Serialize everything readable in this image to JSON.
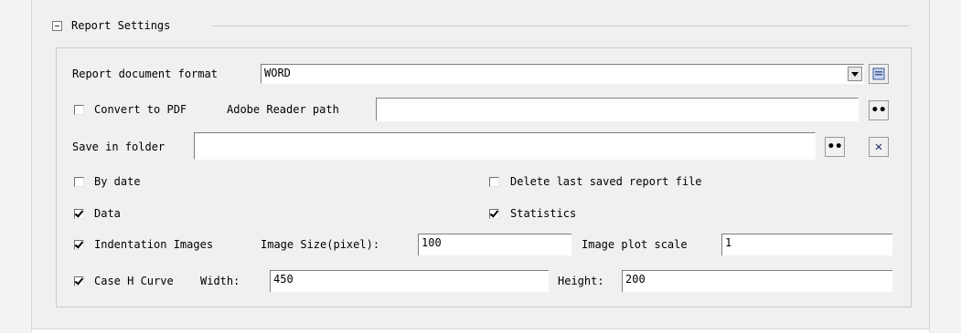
{
  "group": {
    "title": "Report Settings"
  },
  "format": {
    "label": "Report document format",
    "value": "WORD"
  },
  "pdf": {
    "convert_label": "Convert to PDF",
    "reader_path_label": "Adobe Reader path",
    "reader_path_value": ""
  },
  "folder": {
    "label": "Save in folder",
    "value": ""
  },
  "options": {
    "by_date": "By date",
    "delete_last": "Delete last saved report file",
    "data": "Data",
    "statistics": "Statistics"
  },
  "indentation": {
    "label": "Indentation Images",
    "size_label": "Image Size(pixel):",
    "size_value": "100",
    "scale_label": "Image plot scale",
    "scale_value": "1"
  },
  "curve": {
    "label": "Case H Curve",
    "width_label": "Width:",
    "width_value": "450",
    "height_label": "Height:",
    "height_value": "200"
  },
  "buttons": {
    "browse_glyph": "••",
    "clear_glyph": "✕"
  }
}
